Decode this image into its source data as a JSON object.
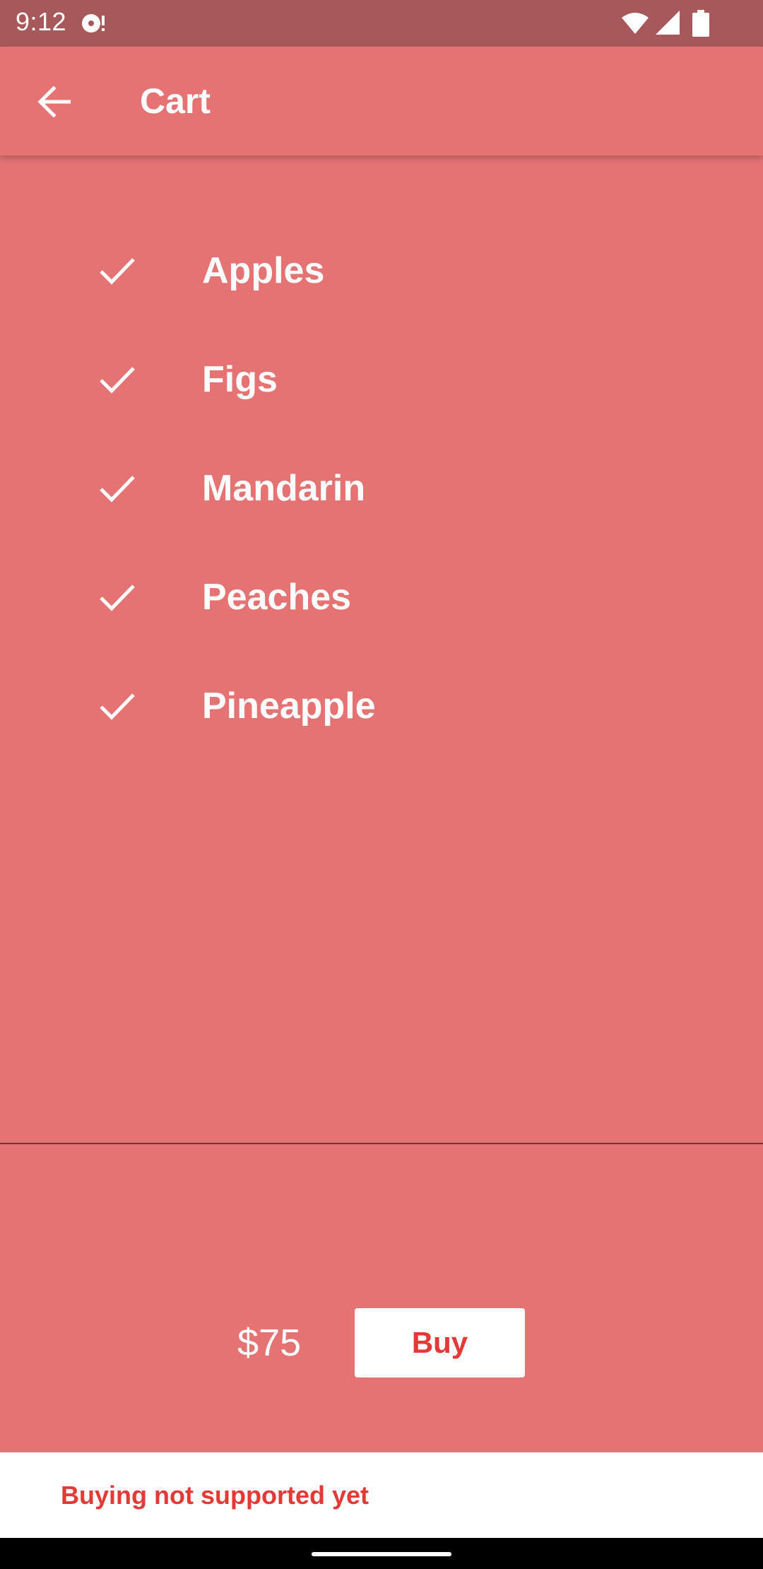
{
  "status_bar": {
    "time": "9:12"
  },
  "app_bar": {
    "title": "Cart",
    "back_icon": "arrow-back-icon"
  },
  "cart": {
    "items": [
      {
        "label": "Apples",
        "icon": "check-icon"
      },
      {
        "label": "Figs",
        "icon": "check-icon"
      },
      {
        "label": "Mandarin",
        "icon": "check-icon"
      },
      {
        "label": "Peaches",
        "icon": "check-icon"
      },
      {
        "label": "Pineapple",
        "icon": "check-icon"
      }
    ]
  },
  "checkout": {
    "total": "$75",
    "buy_label": "Buy"
  },
  "snackbar": {
    "message": "Buying not supported yet"
  },
  "colors": {
    "background": "#e57373",
    "status_bar": "#a6585a",
    "accent_text": "#e53935",
    "surface": "#ffffff"
  }
}
